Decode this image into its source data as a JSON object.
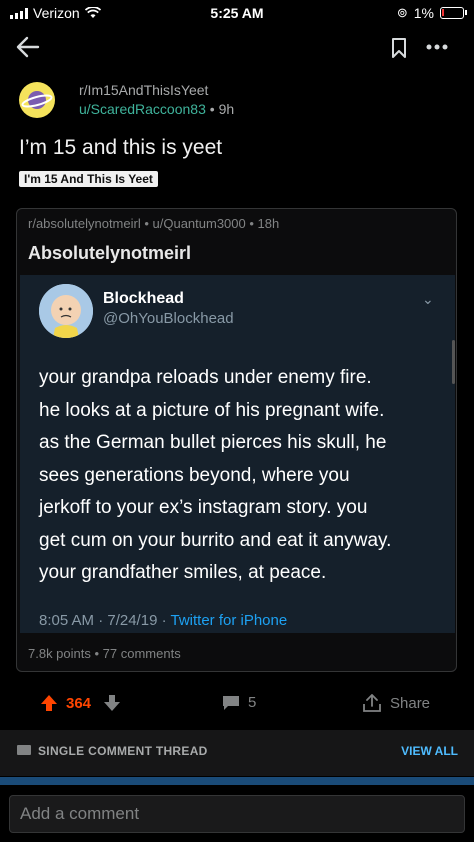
{
  "status_bar": {
    "carrier": "Verizon",
    "time": "5:25 AM",
    "battery": "1%"
  },
  "post": {
    "subreddit": "r/Im15AndThisIsYeet",
    "user": "u/ScaredRaccoon83",
    "age": "9h",
    "title": "I’m 15 and this is yeet",
    "flair": "I'm 15 And This Is Yeet"
  },
  "crosspost": {
    "subreddit": "r/absolutelynotmeirl",
    "user": "u/Quantum3000",
    "age": "18h",
    "title": "Absolutelynotmeirl",
    "points": "7.8k points",
    "comments": "77 comments",
    "tweet": {
      "name": "Blockhead",
      "handle": "@OhYouBlockhead",
      "lines": [
        "your grandpa reloads under enemy fire.",
        "he looks at a picture of his pregnant wife.",
        "as the German bullet pierces his skull, he",
        "sees generations beyond, where you",
        "jerkoff to your ex’s instagram story. you",
        "get cum on your burrito and eat it anyway.",
        "your grandfather smiles, at peace."
      ],
      "timestamp": "8:05 AM · 7/24/19 · ",
      "source": "Twitter for iPhone"
    }
  },
  "actions": {
    "score": "364",
    "comment_count": "5",
    "share_label": "Share"
  },
  "thread_bar": {
    "label": "SINGLE COMMENT THREAD",
    "view_all": "VIEW ALL"
  },
  "comment_input": {
    "placeholder": "Add a comment"
  },
  "colors": {
    "upvote": "#ff4500",
    "link": "#4fbcff",
    "tweet_bg": "#15202b",
    "username": "#3fb39b"
  }
}
